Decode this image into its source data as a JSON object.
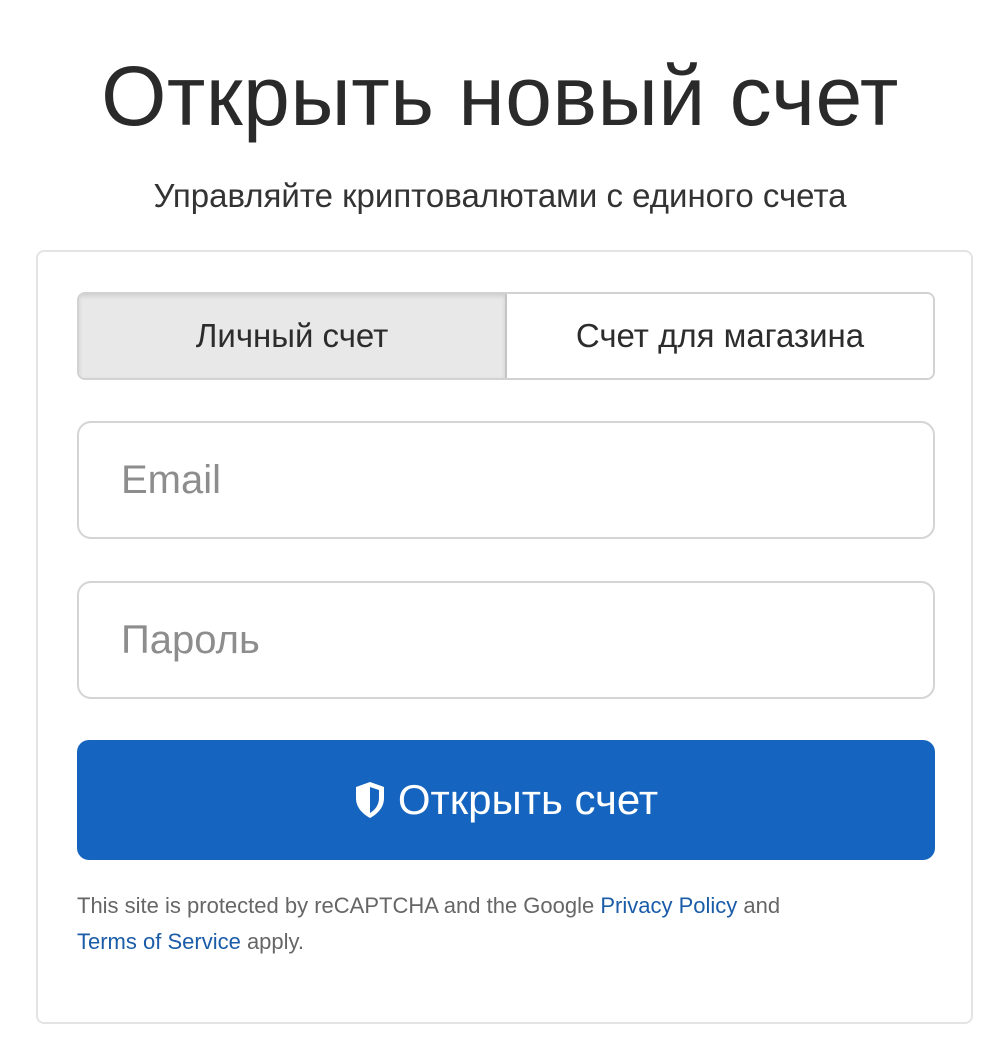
{
  "header": {
    "title": "Открыть новый счет",
    "subtitle": "Управляйте криптовалютами с единого счета"
  },
  "tabs": [
    {
      "label": "Личный счет",
      "active": true
    },
    {
      "label": "Счет для магазина",
      "active": false
    }
  ],
  "form": {
    "email": {
      "placeholder": "Email",
      "value": ""
    },
    "password": {
      "placeholder": "Пароль",
      "value": ""
    },
    "submit_label": "Открыть счет",
    "submit_icon": "shield-icon"
  },
  "recaptcha": {
    "text_1": "This site is protected by reCAPTCHA and the Google ",
    "privacy_link": "Privacy Policy",
    "text_2": " and ",
    "terms_link": "Terms of Service",
    "text_3": " apply."
  },
  "colors": {
    "primary": "#1565c0",
    "link": "#1a5ca8",
    "active_tab": "#e8e8e8"
  }
}
